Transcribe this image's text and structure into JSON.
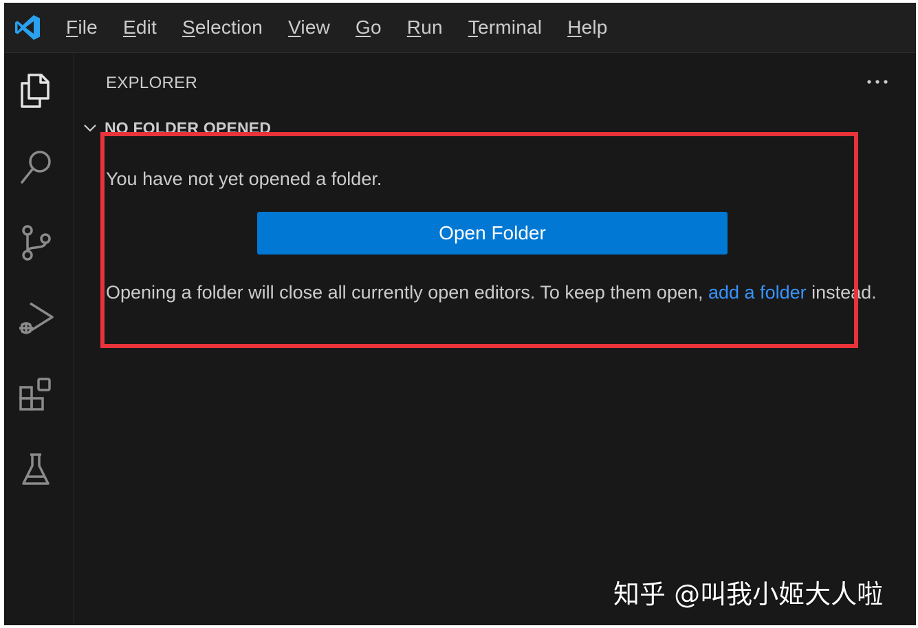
{
  "titlebar": {
    "menu": [
      {
        "pre": "",
        "key": "F",
        "post": "ile"
      },
      {
        "pre": "",
        "key": "E",
        "post": "dit"
      },
      {
        "pre": "",
        "key": "S",
        "post": "election"
      },
      {
        "pre": "",
        "key": "V",
        "post": "iew"
      },
      {
        "pre": "",
        "key": "G",
        "post": "o"
      },
      {
        "pre": "",
        "key": "R",
        "post": "un"
      },
      {
        "pre": "",
        "key": "T",
        "post": "erminal"
      },
      {
        "pre": "",
        "key": "H",
        "post": "elp"
      }
    ]
  },
  "activity_bar": {
    "icons": [
      "explorer-icon",
      "search-icon",
      "source-control-icon",
      "run-debug-icon",
      "extensions-icon",
      "testing-icon"
    ]
  },
  "sidebar": {
    "title": "EXPLORER",
    "section_title": "NO FOLDER OPENED",
    "message": "You have not yet opened a folder.",
    "open_button": "Open Folder",
    "note_prefix": "Opening a folder will close all currently open editors. To keep them open, ",
    "note_link": "add a folder",
    "note_suffix": " instead."
  },
  "watermark": "知乎 @叫我小姬大人啦",
  "colors": {
    "background": "#181818",
    "button": "#0078d4",
    "link": "#3794ff",
    "annotation": "#e8333b"
  }
}
